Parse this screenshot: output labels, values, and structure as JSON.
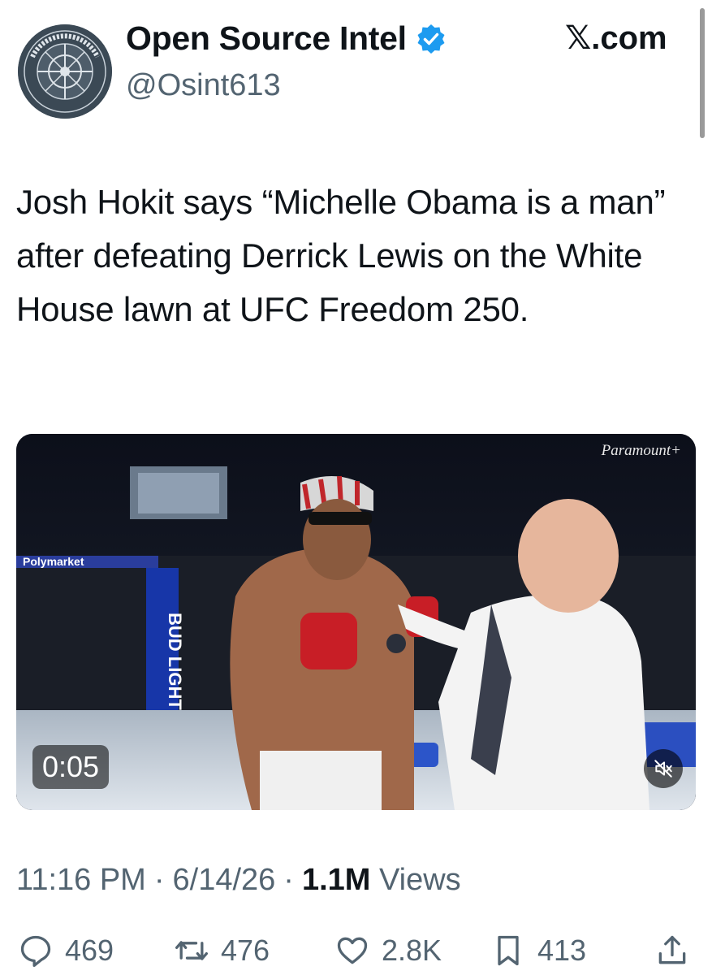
{
  "author": {
    "display_name": "Open Source Intel",
    "handle": "@Osint613",
    "verified": true,
    "avatar_text": "OPEN SOURCE INTEL"
  },
  "source_label": "𝕏.com",
  "tweet": {
    "text": "Josh Hokit says “Michelle Obama is a man” after defeating Derrick Lewis on the White House lawn at UFC Freedom 250."
  },
  "media": {
    "watermark": "Paramount+",
    "duration": "0:05",
    "mute_icon": "speaker-muted-icon",
    "banners": [
      "Polymarket",
      "BUD LIGHT"
    ]
  },
  "meta": {
    "time": "11:16 PM",
    "separator": "·",
    "date": "6/14/26",
    "views_count": "1.1M",
    "views_label": "Views"
  },
  "actions": {
    "replies": "469",
    "reposts": "476",
    "likes": "2.8K",
    "bookmarks": "413"
  },
  "colors": {
    "verified_blue": "#1d9bf0",
    "secondary_text": "#536471",
    "primary_text": "#0f1419"
  }
}
